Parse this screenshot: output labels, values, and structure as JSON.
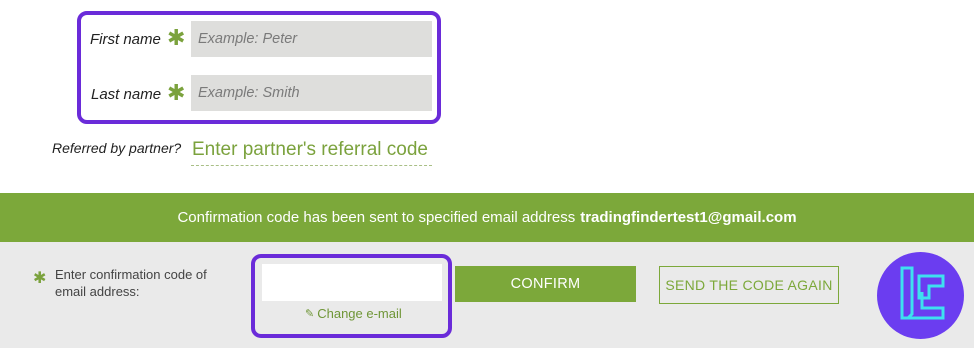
{
  "form": {
    "first_name": {
      "label": "First name",
      "required": "✱",
      "placeholder": "Example: Peter",
      "value": ""
    },
    "last_name": {
      "label": "Last name",
      "required": "✱",
      "placeholder": "Example: Smith",
      "value": ""
    },
    "referral": {
      "label": "Referred by partner?",
      "placeholder": "Enter partner's referral code"
    }
  },
  "banner": {
    "message": "Confirmation code has been sent to specified email address",
    "email": "tradingfindertest1@gmail.com"
  },
  "confirmation": {
    "required": "✱",
    "label": "Enter confirmation code of email address:",
    "code_value": "",
    "change_email": "Change e-mail",
    "confirm_button": "CONFIRM",
    "resend_button": "SEND THE CODE AGAIN"
  },
  "icons": {
    "pencil": "pencil-icon",
    "logo": "brand-logo-icon"
  },
  "colors": {
    "accent_green": "#7ca83a",
    "highlight_purple": "#6a2bd9",
    "logo_bg": "#6b3df0",
    "logo_stroke": "#3ee0ef"
  }
}
